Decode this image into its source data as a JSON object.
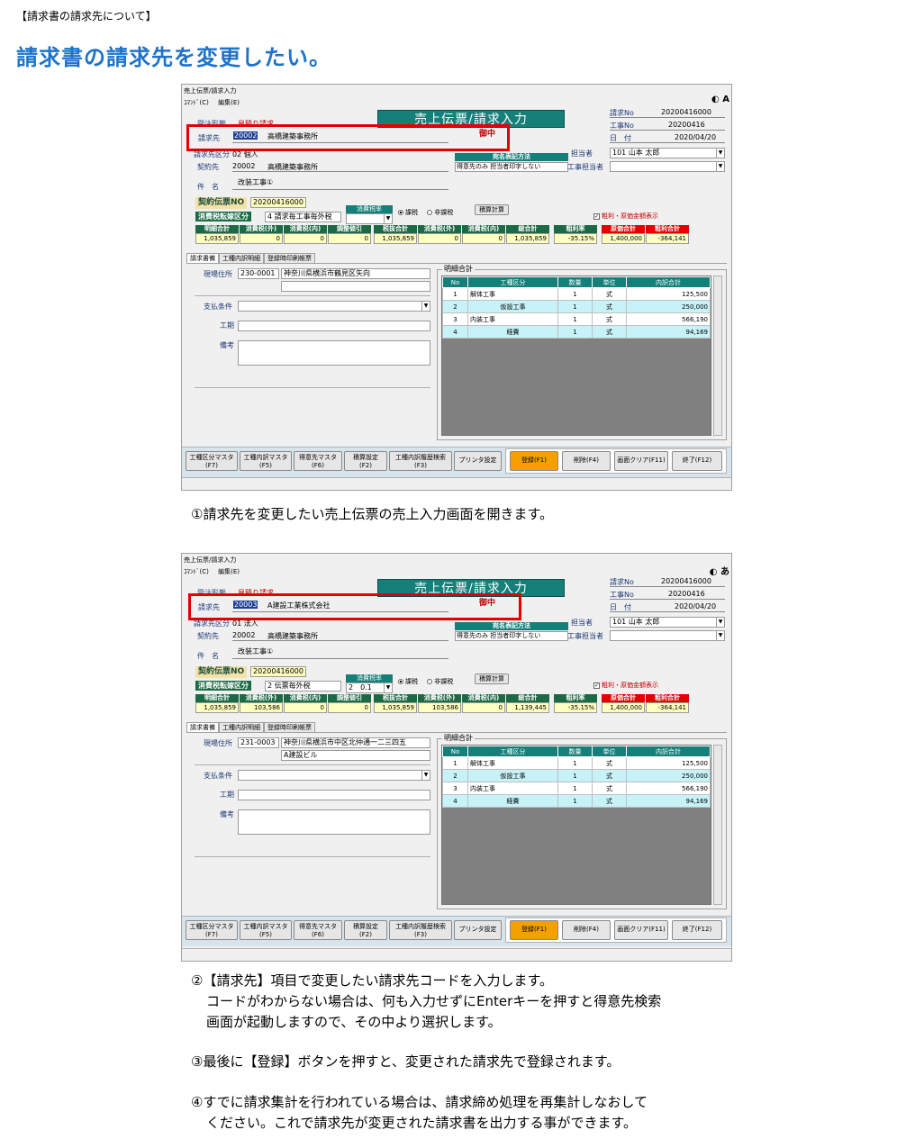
{
  "header": {
    "section_label": "【請求書の請求先について】",
    "title": "請求書の請求先を変更したい。"
  },
  "screen": {
    "window_title": "売上伝票/請求入力",
    "menu": [
      "ｺﾏﾝﾄﾞ(C)",
      "編集(E)"
    ],
    "title_banner": "売上伝票/請求入力",
    "gochu": "御中",
    "labels": {
      "juchu_keitai": "受注形態",
      "seikyusaki": "請求先",
      "seikyusaki_kubun": "請求先区分",
      "keiyakusaki": "契約先",
      "kenmei": "件　名",
      "keiyaku_no": "契約伝票NO",
      "tax_rate": "消費税率",
      "tax_kubun": "消費税転嫁区分",
      "kazei": "課税",
      "hikazei": "非課税",
      "sekisan_keisan": "積算計算",
      "atena": "宛名表記方法",
      "atena_value": "得意先のみ 担当者印字しない",
      "tantosha": "担当者",
      "koji_tantosha": "工事担当者",
      "seikyu_no": "請求No",
      "koji_no": "工事No",
      "hizuke": "日　付",
      "show_cost": "粗利・原価金額表示",
      "genba_jusho": "現場住所",
      "shiharai": "支払条件",
      "koki": "工期",
      "biko": "備考",
      "meisai_gokei": "明細合計"
    },
    "totals_headers": [
      "明細合計",
      "消費税(外)",
      "消費税(内)",
      "調整値引",
      "税抜合計",
      "消費税(外)",
      "消費税(内)",
      "総合計",
      "粗利率",
      "原価合計",
      "粗利合計"
    ],
    "tabs": [
      "請求書備",
      "工種内訳明細",
      "登録時印刷帳票"
    ],
    "grid_headers": [
      "No",
      "工種区分",
      "数量",
      "単位",
      "内訳合計"
    ],
    "grid_rows": [
      {
        "no": "1",
        "kubun": "解体工事",
        "qty": "1",
        "unit": "式",
        "amount": "125,500"
      },
      {
        "no": "2",
        "kubun": "仮設工事",
        "qty": "1",
        "unit": "式",
        "amount": "250,000"
      },
      {
        "no": "3",
        "kubun": "内装工事",
        "qty": "1",
        "unit": "式",
        "amount": "566,190"
      },
      {
        "no": "4",
        "kubun": "経費",
        "qty": "1",
        "unit": "式",
        "amount": "94,169"
      }
    ],
    "buttons": [
      {
        "l1": "工種区分マスタ",
        "l2": "(F7)"
      },
      {
        "l1": "工種内訳マスタ",
        "l2": "(F5)"
      },
      {
        "l1": "得意先マスタ",
        "l2": "(F6)"
      },
      {
        "l1": "積算設定",
        "l2": "(F2)"
      },
      {
        "l1": "工種内訳履歴検索",
        "l2": "(F3)"
      },
      {
        "l1": "プリンタ設定",
        "l2": ""
      },
      {
        "l1": "登録(F1)",
        "l2": ""
      },
      {
        "l1": "削除(F4)",
        "l2": ""
      },
      {
        "l1": "画面クリア(F11)",
        "l2": ""
      },
      {
        "l1": "終了(F12)",
        "l2": ""
      }
    ]
  },
  "shot1": {
    "ime": "A",
    "juchu_value": "見積り請求",
    "seikyusaki_code": "20002",
    "seikyusaki_name": "高橋建築事務所",
    "kubun_value": "02 個人",
    "keiyaku_code": "20002",
    "keiyaku_name": "高橋建築事務所",
    "kenmei_value": "改装工事①",
    "keiyaku_no_value": "20200416000",
    "tax_kubun_value": "4 請求毎工事毎外税",
    "tax_rate_value": "",
    "tantosha_value": "101 山本 太郎",
    "seikyu_no_value": "20200416000",
    "koji_no_value": "20200416",
    "date_value": "2020/04/20",
    "totals": [
      "1,035,859",
      "0",
      "0",
      "0",
      "1,035,859",
      "0",
      "0",
      "1,035,859",
      "-35.15%",
      "1,400,000",
      "-364,141"
    ],
    "zip": "230-0001",
    "address1": "神奈川県横浜市鶴見区矢向",
    "address2": ""
  },
  "shot2": {
    "ime": "あ",
    "juchu_value": "見積り請求",
    "seikyusaki_code": "20003",
    "seikyusaki_name": "A建設工業株式会社",
    "kubun_value": "01 法人",
    "keiyaku_code": "20002",
    "keiyaku_name": "高橋建築事務所",
    "kenmei_value": "改装工事①",
    "keiyaku_no_value": "20200416000",
    "tax_kubun_value": "2 伝票毎外税",
    "tax_rate_value": "2　0.1",
    "tantosha_value": "101 山本 太郎",
    "seikyu_no_value": "20200416000",
    "koji_no_value": "20200416",
    "date_value": "2020/04/20",
    "totals": [
      "1,035,859",
      "103,586",
      "0",
      "0",
      "1,035,859",
      "103,586",
      "0",
      "1,139,445",
      "-35.15%",
      "1,400,000",
      "-364,141"
    ],
    "zip": "231-0003",
    "address1": "神奈川県横浜市中区北仲通一二三四五",
    "address2": "A建設ビル"
  },
  "steps": {
    "s1": "①請求先を変更したい売上伝票の売上入力画面を開きます。",
    "s2_l1": "②【請求先】項目で変更したい請求先コードを入力します。",
    "s2_l2": "コードがわからない場合は、何も入力せずにEnterキーを押すと得意先検索",
    "s2_l3": "画面が起動しますので、その中より選択します。",
    "s3": "③最後に【登録】ボタンを押すと、変更された請求先で登録されます。",
    "s4_l1": "④すでに請求集計を行われている場合は、請求締め処理を再集計しなおして",
    "s4_l2": "ください。これで請求先が変更された請求書を出力する事ができます。"
  }
}
